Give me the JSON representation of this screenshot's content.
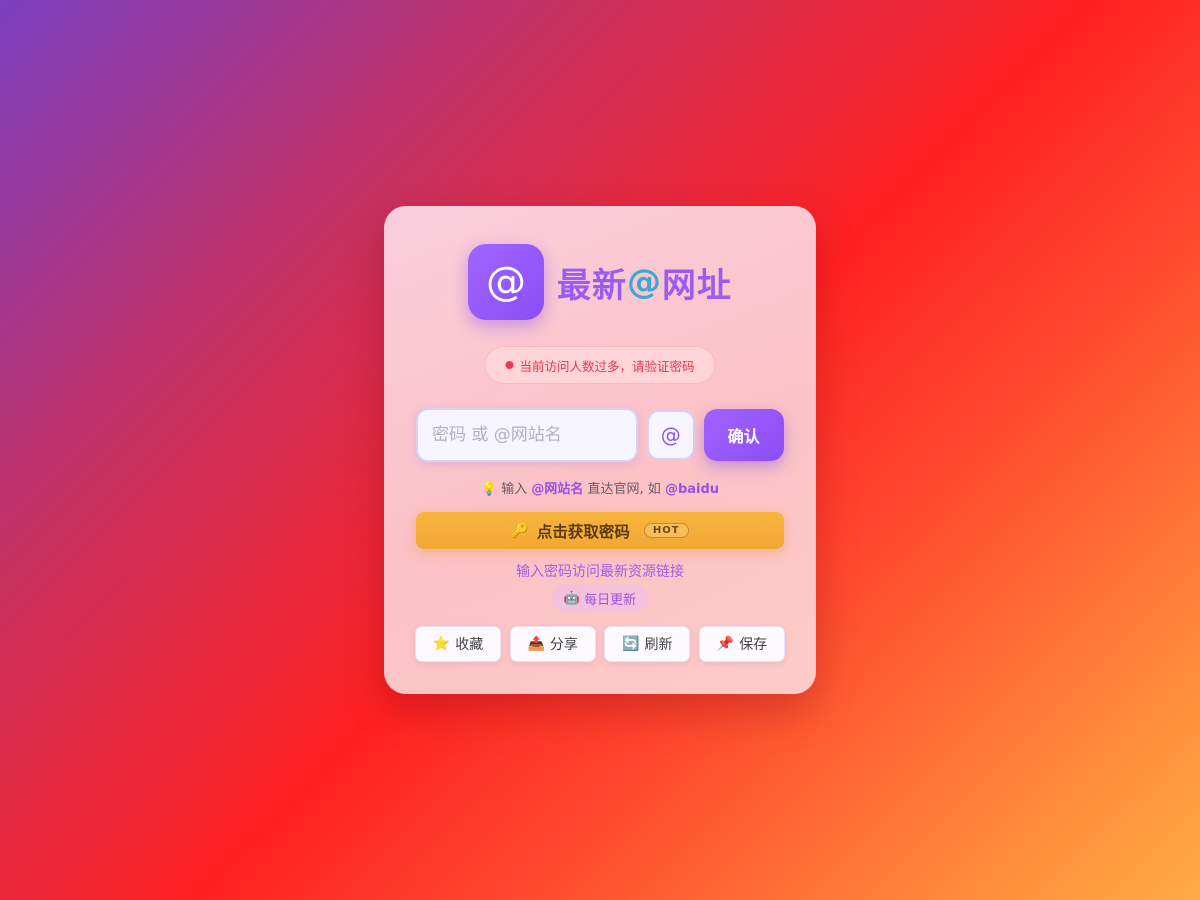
{
  "logo": {
    "icon": "@",
    "brand_part1": "最新",
    "brand_at": "@",
    "brand_part2": "网址"
  },
  "alert": {
    "text": "当前访问人数过多，请验证密码"
  },
  "form": {
    "placeholder": "密码 或 @网站名",
    "at_button": "@",
    "confirm_label": "确认"
  },
  "hint": {
    "prefix": "💡 输入 ",
    "site_token": "@网站名",
    "middle": " 直达官网, 如 ",
    "example": "@baidu"
  },
  "get_password": {
    "icon": "🔑",
    "label": "点击获取密码",
    "badge": "HOT"
  },
  "description": "输入密码访问最新资源链接",
  "daily": {
    "icon": "🤖",
    "label": "每日更新"
  },
  "actions": [
    {
      "icon": "⭐",
      "label": "收藏"
    },
    {
      "icon": "📤",
      "label": "分享"
    },
    {
      "icon": "🔄",
      "label": "刷新"
    },
    {
      "icon": "📌",
      "label": "保存"
    }
  ],
  "colors": {
    "accent_purple": "#9a5cf2",
    "at_cyan": "#3aa7d4",
    "alert_red": "#e5384f",
    "cta_orange": "#f3a833"
  }
}
